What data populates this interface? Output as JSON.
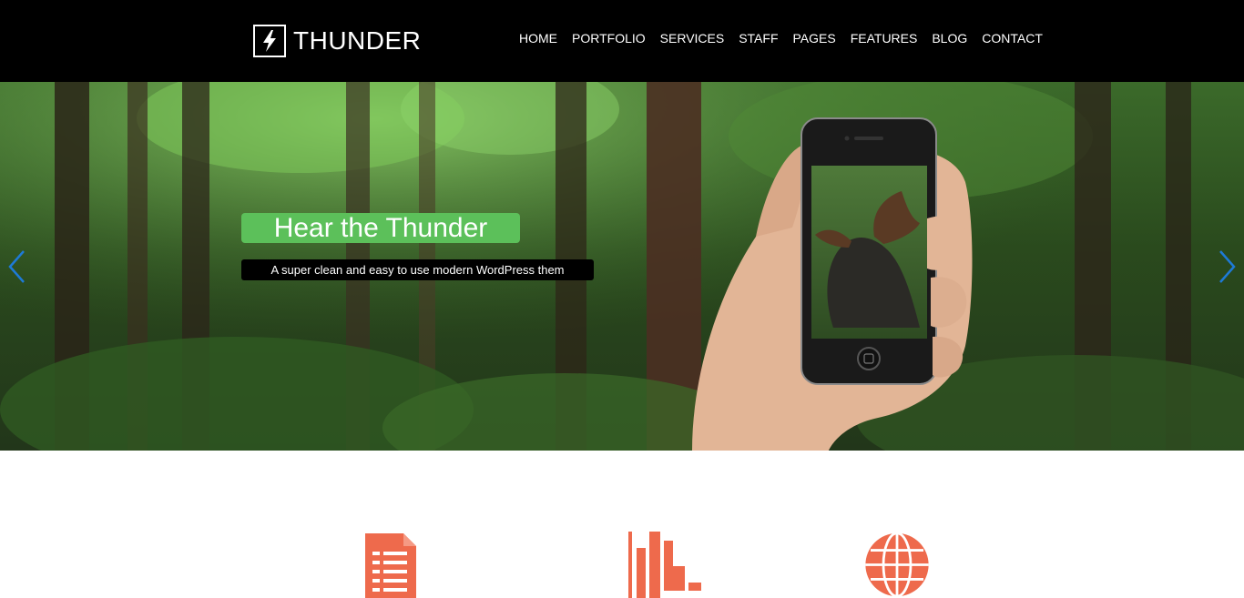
{
  "header": {
    "logo_text": "THUNDER",
    "nav": [
      "HOME",
      "PORTFOLIO",
      "SERVICES",
      "STAFF",
      "PAGES",
      "FEATURES",
      "BLOG",
      "CONTACT"
    ]
  },
  "hero": {
    "title": "Hear the Thunder",
    "subtitle": "A super clean and easy to use modern WordPress them"
  },
  "features": {
    "icons": [
      "document-icon",
      "bar-chart-icon",
      "globe-icon"
    ]
  },
  "colors": {
    "accent_green": "#5cc05a",
    "feature_orange": "#ee6a4c",
    "arrow_blue": "#1e7ad6",
    "header_bg": "#000000"
  }
}
